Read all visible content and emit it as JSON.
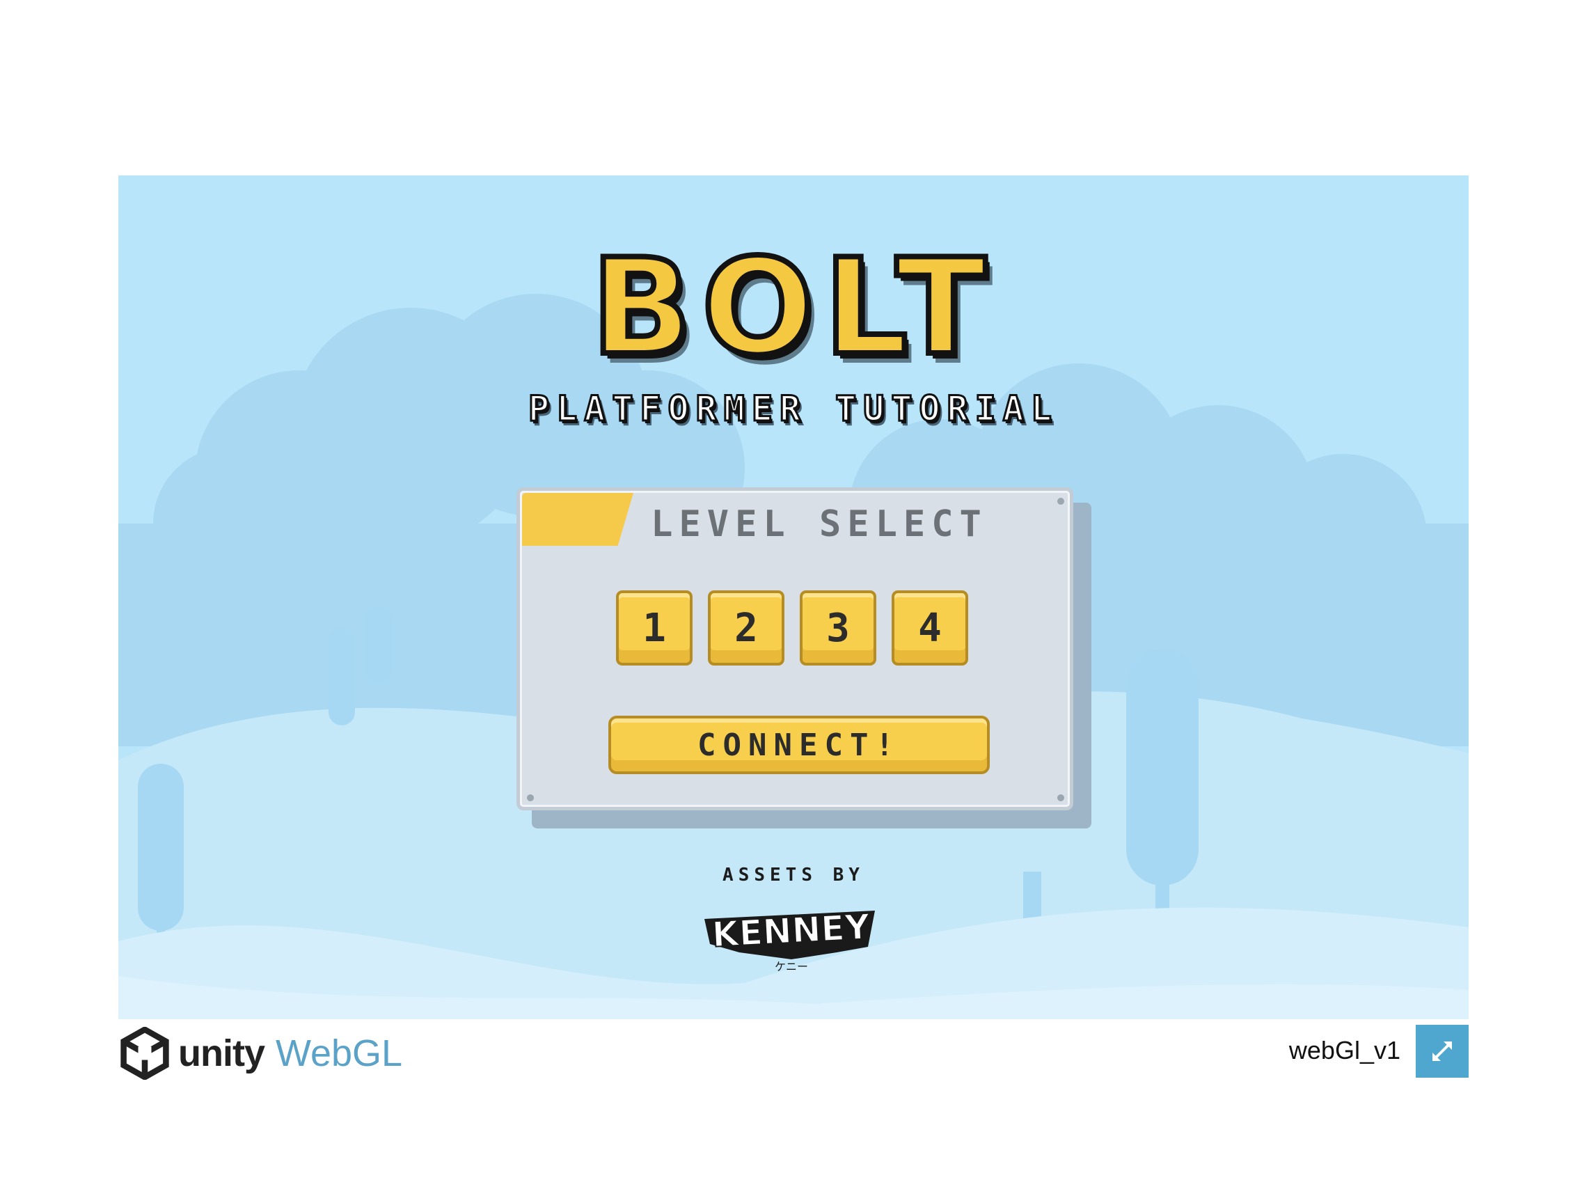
{
  "game": {
    "title": "BOLT",
    "subtitle": "PLATFORMER TUTORIAL",
    "panel": {
      "title": "LEVEL SELECT",
      "levels": [
        "1",
        "2",
        "3",
        "4"
      ],
      "connect_label": "CONNECT!"
    },
    "credits": {
      "assets_by": "ASSETS BY",
      "brand": "KENNEY",
      "brand_kana": "ケニー"
    }
  },
  "footer": {
    "unity_word": "unity",
    "webgl_word": "WebGL",
    "build_title": "webGl_v1"
  },
  "icons": {
    "unity": "unity-logo-icon",
    "fullscreen": "fullscreen-icon"
  },
  "colors": {
    "sky": "#b9e5fb",
    "accent_yellow": "#f5c842",
    "fullscreen_button": "#4fa7cf",
    "webgl_blue": "#5ba2c8"
  }
}
